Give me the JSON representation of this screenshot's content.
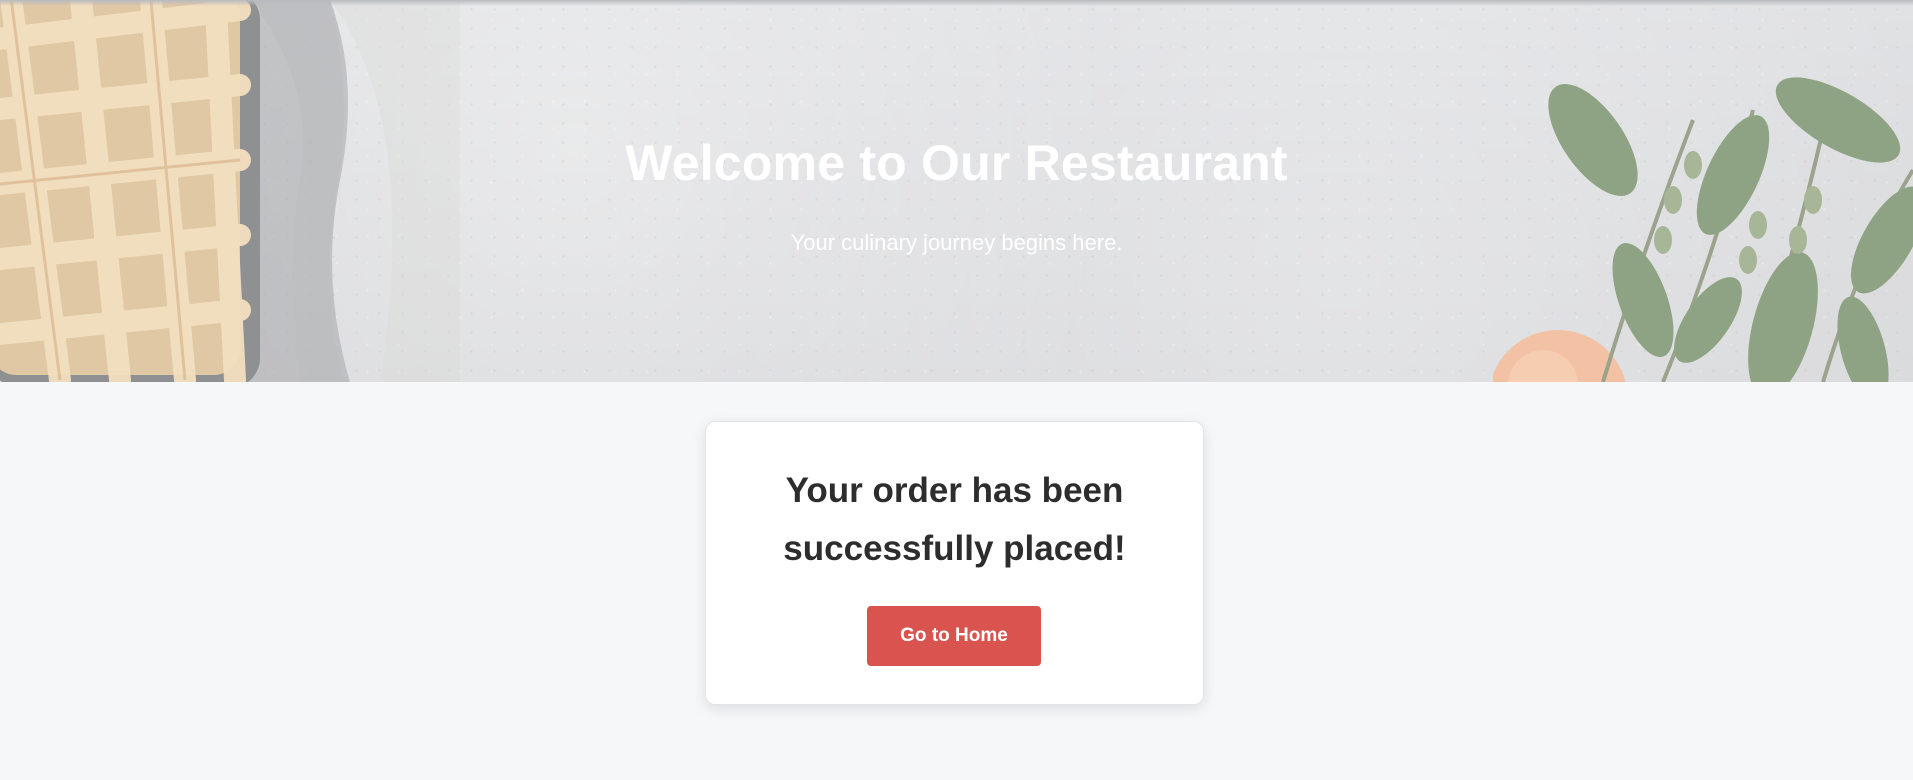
{
  "hero": {
    "title": "Welcome to Our Restaurant",
    "subtitle": "Your culinary journey begins here."
  },
  "confirmation": {
    "message": "Your order has been successfully placed!",
    "button_label": "Go to Home"
  },
  "colors": {
    "accent": "#d9534f",
    "page_background": "#f6f7f9",
    "heading_text": "#2d2d2d"
  }
}
